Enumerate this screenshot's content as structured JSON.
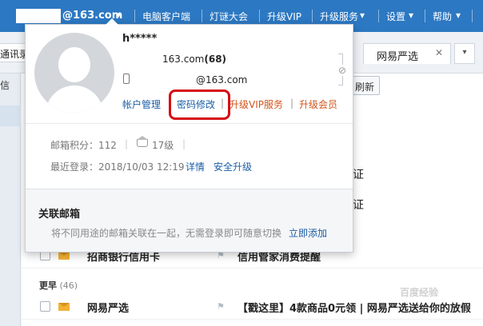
{
  "topbar": {
    "account": "@163.com",
    "nav": [
      "电脑客户端",
      "灯谜大会",
      "升级VIP",
      "升级服务",
      "设置",
      "帮助"
    ]
  },
  "tabs": {
    "left_partial": "通讯录",
    "yanxuan": "网易严选",
    "close": "✕"
  },
  "sidebar": {
    "partial_text": "信"
  },
  "main": {
    "refresh_label": "刷新",
    "partial_rows": [
      "证",
      "证"
    ],
    "rows": [
      {
        "sender": "招商银行信用卡",
        "subject": "信用管家消费提醒"
      },
      {
        "sender": "网易严选",
        "subject": "【戳这里】4款商品0元领 | 网易严选送给你的放假"
      }
    ],
    "group_earlier": {
      "label": "更早",
      "count": "(46)"
    }
  },
  "popup": {
    "username": "h*****",
    "email_primary_suffix": "163.com",
    "email_primary_count": "(68)",
    "email_secondary": "@163.com",
    "actions": {
      "account_manage": "帐户管理",
      "password_change": "密码修改",
      "upgrade_vip": "升级VIP服务",
      "upgrade_member": "升级会员"
    },
    "score_label": "邮箱积分：112",
    "level": "17级",
    "last_login": "最近登录：2018/10/03 12:19",
    "details": "详情",
    "security_upgrade": "安全升级",
    "linked": {
      "title": "关联邮箱",
      "desc": "将不同用途的邮箱关联在一起，无需登录即可随意切换",
      "add": "立即添加"
    }
  },
  "watermark": "百度经验"
}
